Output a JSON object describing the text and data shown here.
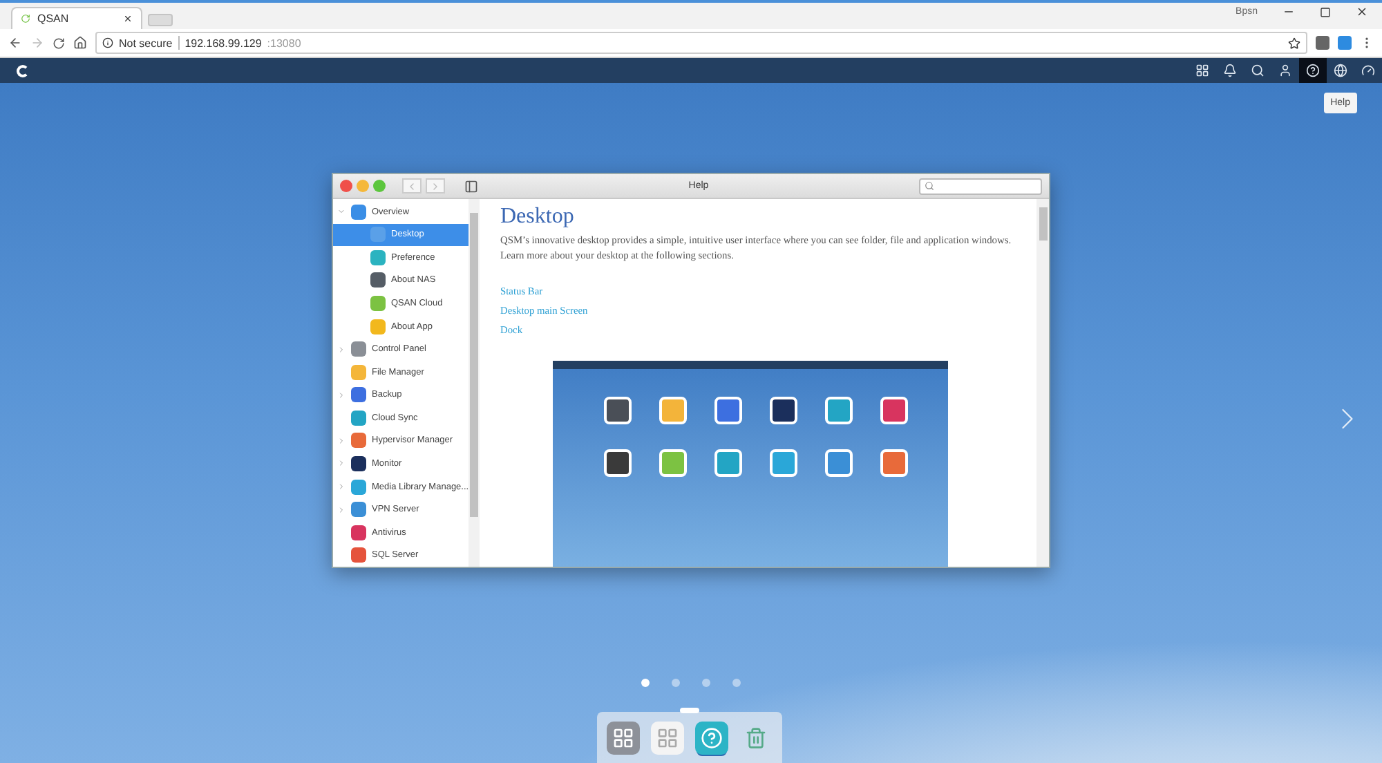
{
  "browser": {
    "tab": {
      "title": "QSAN"
    },
    "user": "Bpsn",
    "address": {
      "security": "Not secure",
      "host": "192.168.99.129",
      "port": ":13080"
    }
  },
  "topbar": {
    "icons": [
      {
        "kind": "grid",
        "selected": false
      },
      {
        "kind": "bell",
        "selected": false
      },
      {
        "kind": "search",
        "selected": false
      },
      {
        "kind": "user",
        "selected": false
      },
      {
        "kind": "help",
        "selected": true
      },
      {
        "kind": "globe",
        "selected": false
      },
      {
        "kind": "gauge",
        "selected": false
      }
    ],
    "tooltip": "Help"
  },
  "help_window": {
    "title": "Help",
    "sidebar": [
      {
        "label": "Overview",
        "expanded": true,
        "selected": false,
        "color": "#3a8ee6",
        "children": [
          {
            "label": "Desktop",
            "selected": true,
            "color": "#5aa0e8"
          },
          {
            "label": "Preference",
            "selected": false,
            "color": "#2bb3c0"
          },
          {
            "label": "About NAS",
            "selected": false,
            "color": "#555d66"
          },
          {
            "label": "QSAN Cloud",
            "selected": false,
            "color": "#7cc242"
          },
          {
            "label": "About App",
            "selected": false,
            "color": "#f2b81d"
          }
        ]
      },
      {
        "label": "Control Panel",
        "expanded": false,
        "selected": false,
        "color": "#8a8f96"
      },
      {
        "label": "File Manager",
        "selected": false,
        "color": "#f4b63a"
      },
      {
        "label": "Backup",
        "expanded": false,
        "selected": false,
        "color": "#3d6fe0"
      },
      {
        "label": "Cloud Sync",
        "selected": false,
        "color": "#23a5c4"
      },
      {
        "label": "Hypervisor Manager",
        "expanded": false,
        "selected": false,
        "color": "#e86a3a"
      },
      {
        "label": "Monitor",
        "expanded": false,
        "selected": false,
        "color": "#1b2f5c"
      },
      {
        "label": "Media Library Manage...",
        "expanded": false,
        "selected": false,
        "color": "#2aa7d8"
      },
      {
        "label": "VPN Server",
        "expanded": false,
        "selected": false,
        "color": "#3b8fd6"
      },
      {
        "label": "Antivirus",
        "selected": false,
        "color": "#d8345f"
      },
      {
        "label": "SQL Server",
        "selected": false,
        "color": "#e5533c"
      }
    ],
    "content": {
      "heading": "Desktop",
      "body": "QSM’s innovative desktop provides a simple, intuitive user interface where you can see folder, file and application windows. Learn more about your desktop at the following sections.",
      "links": [
        "Status Bar",
        "Desktop main Screen",
        "Dock"
      ],
      "preview": {
        "kind": "screenshot",
        "apps": [
          {
            "color": "#4a4f57"
          },
          {
            "color": "#f3b43a"
          },
          {
            "color": "#3d6fe0"
          },
          {
            "color": "#1b2f5c"
          },
          {
            "color": "#23a5c4"
          },
          {
            "color": "#d8345f"
          },
          {
            "color": "#3a3a3a"
          },
          {
            "color": "#7cc242"
          },
          {
            "color": "#23a5c4"
          },
          {
            "color": "#2aa7d8"
          },
          {
            "color": "#3b8fd6"
          },
          {
            "color": "#e86a3a"
          }
        ]
      }
    }
  },
  "pager": [
    {
      "selected": true
    },
    {
      "selected": false
    },
    {
      "selected": false
    },
    {
      "selected": false
    }
  ],
  "dock": [
    {
      "kind": "control-panel",
      "selected": false
    },
    {
      "kind": "apps",
      "selected": false
    },
    {
      "kind": "help",
      "selected": true
    },
    {
      "kind": "trash",
      "selected": false
    }
  ]
}
